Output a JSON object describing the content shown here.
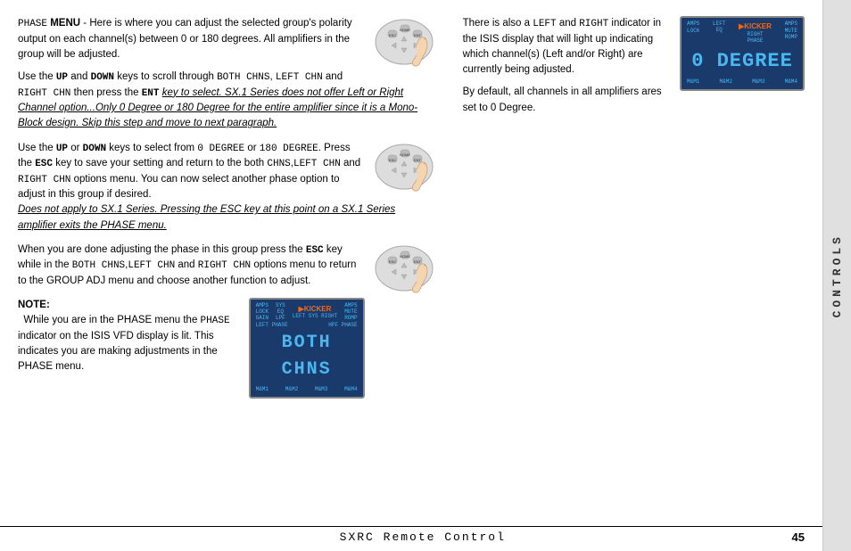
{
  "sidebar": {
    "text": "CONTROLS"
  },
  "footer": {
    "title": "SXRC Remote Control",
    "page": "45"
  },
  "left_col": {
    "para1": {
      "prefix_mono": "PHASE",
      "prefix_bold": " MENU",
      "body": " - Here is where you can adjust the selected group's polarity output on each channel(s) between 0 or 180 degrees. All amplifiers in the group will be adjusted."
    },
    "para2": {
      "line1_prefix": "Use the ",
      "up_mono": "UP",
      "line1_mid": " and ",
      "down_mono": "DOWN",
      "line1_suffix": " keys to scroll through ",
      "both_mono": "BOTH CHNS",
      "comma": ", ",
      "left_mono": "LEFT CHN",
      "and": " and ",
      "right_mono": "RIGHT CHN",
      "line2_prefix": " then press the ",
      "ent_mono": "ENT",
      "line2_suffix_italic": " key to select. SX.1 Series does not offer Left or Right Channel option...Only 0 Degree or 180 Degree for the entire amplifier since it is a Mono-Block design. Skip this step and move to next paragraph."
    },
    "para3": {
      "line1": "Use the ",
      "up2_mono": "UP",
      "line1_mid": " or ",
      "down2_mono": "DOWN",
      "line1_suffix": " keys to select from ",
      "zero_mono": "0 DEGREE",
      "or": " or ",
      "one80_mono": "180 DEGREE",
      "press": ". Press the ",
      "esc_mono": "ESC",
      "line2": "key to save your setting and return to the both ",
      "both2_mono": "CHNS",
      "left2_mono": "LEFT CHN",
      "and2": " and ",
      "right2_mono": "RIGHT CHN",
      "options": " options menu. You can now select another phase option to adjust in this group if desired.",
      "italic_note": "Does not apply to SX.1 Series. Pressing the ESC key at this point on a SX.1 Series amplifier exits the PHASE menu."
    },
    "para4": {
      "line1": "When you are done adjusting the phase in this group press the ",
      "esc2_mono": "ESC",
      "line1_suffix": " key while in the ",
      "both3_mono": "BOTH CHNS",
      "left3_mono": "LEFT CHN",
      "and3": " and ",
      "right3_mono": "RIGHT CHN",
      "line2": " options menu to return to the GROUP ADJ menu and choose another function to adjust."
    },
    "note": {
      "label": "NOTE:",
      "body_prefix": " While you are in the PHASE menu the ",
      "phase_mono": "PHASE",
      "body_suffix": " indicator on the ISIS VFD display is lit. This indicates you are making adjustments in the PHASE menu."
    }
  },
  "right_col": {
    "para1": {
      "line1": "There is also a ",
      "left_mono": "LEFT",
      "and": " and ",
      "right_mono": "RIGHT",
      "line1_suffix": " indicator in the ISIS display that will light up indicating which channel(s) (Left and/or Right) are currently being adjusted."
    },
    "para2": "By default, all channels in all amplifiers ares set to 0 Degree."
  },
  "lcd_displays": {
    "zero_degree": "0 DEGREE",
    "both_chns": "BOTH CHNS"
  },
  "colors": {
    "lcd_bg": "#1a3a6b",
    "lcd_text": "#4ab8f0",
    "kicker_orange": "#ff6600"
  }
}
